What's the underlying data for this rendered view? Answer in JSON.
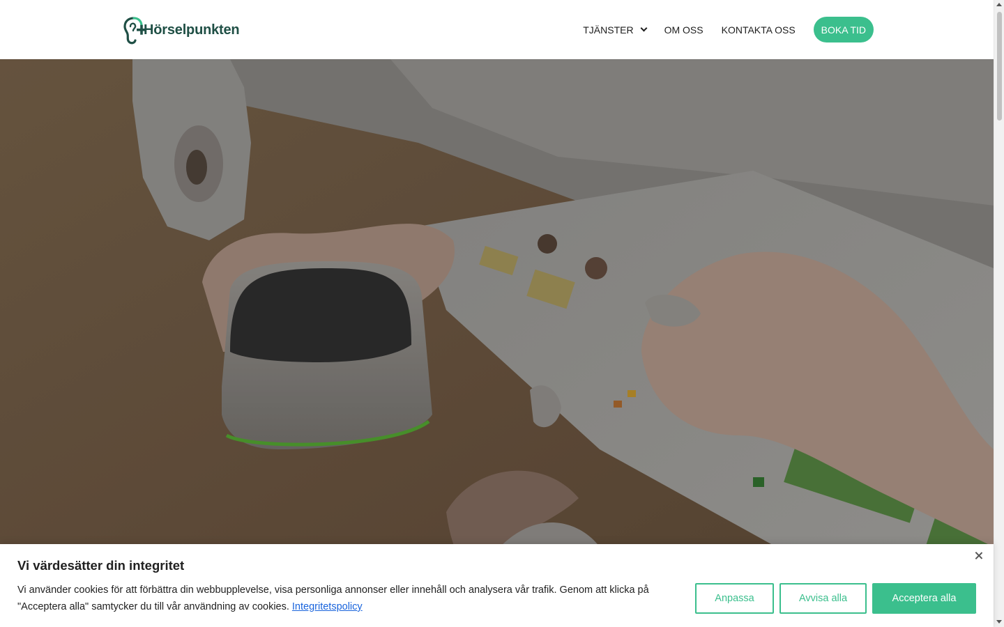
{
  "brand": {
    "name": "Hörselpunkten",
    "accent": "#3bbf8d",
    "dark": "#1f4f45"
  },
  "nav": {
    "items": [
      {
        "label": "TJÄNSTER",
        "has_dropdown": true
      },
      {
        "label": "OM OSS"
      },
      {
        "label": "KONTAKTA OSS"
      }
    ],
    "cta": "BOKA TID"
  },
  "hero": {
    "image": "hearing-aids-consultation-photo"
  },
  "cookie": {
    "title": "Vi värdesätter din integritet",
    "text": "Vi använder cookies för att förbättra din webbupplevelse, visa personliga annonser eller innehåll och analysera vår trafik. Genom att klicka på \"Acceptera alla\" samtycker du till vår användning av cookies.",
    "link": "Integritetspolicy",
    "buttons": {
      "customize": "Anpassa",
      "reject": "Avvisa alla",
      "accept": "Acceptera alla"
    }
  }
}
